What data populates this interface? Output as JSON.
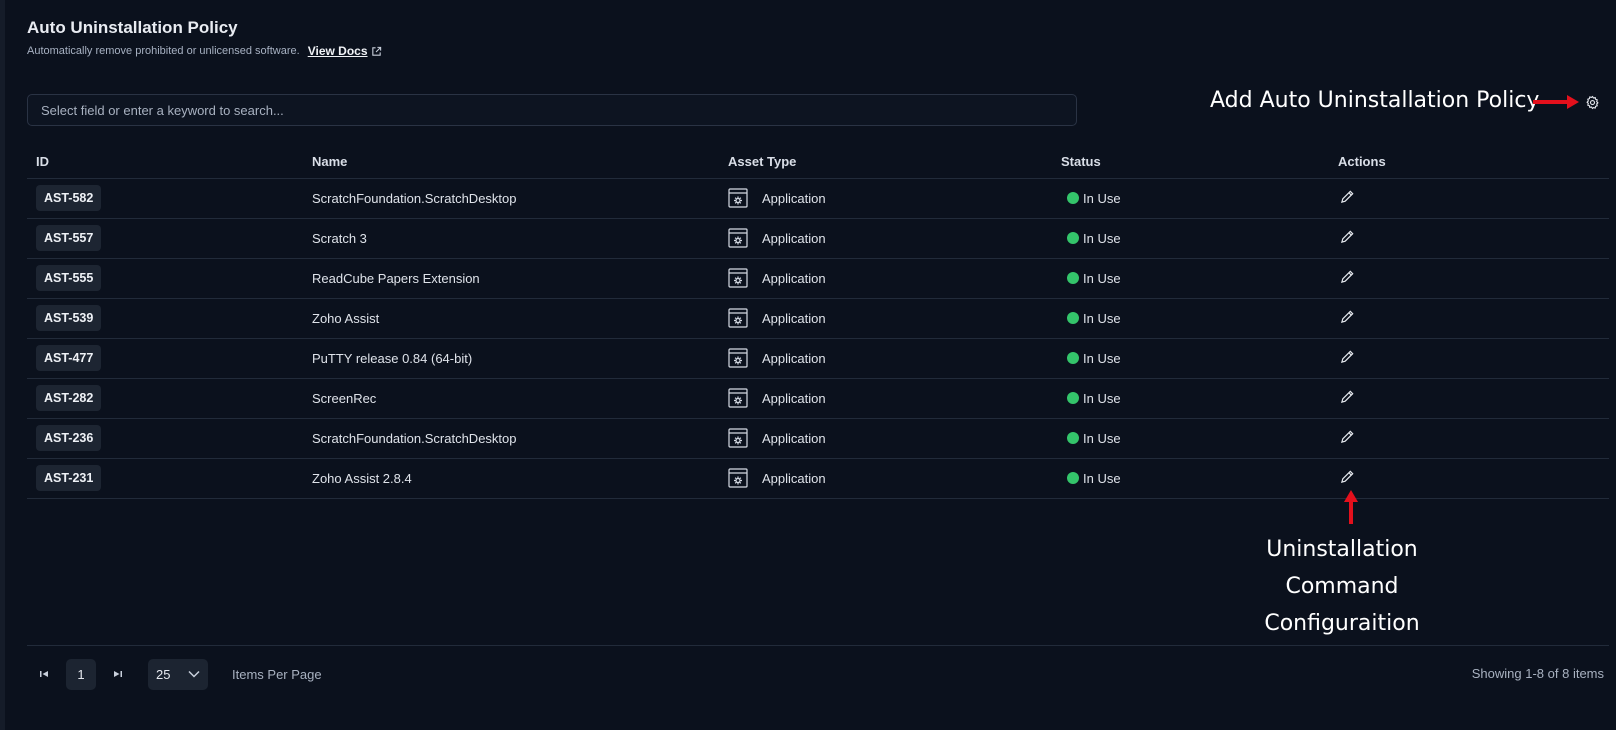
{
  "header": {
    "title": "Auto Uninstallation Policy",
    "subtitle": "Automatically remove prohibited or unlicensed software.",
    "docs_link": "View Docs"
  },
  "search": {
    "placeholder": "Select field or enter a keyword to search..."
  },
  "annotations": {
    "add_policy": "Add Auto Uninstallation Policy",
    "command_line1": "Uninstallation Command",
    "command_line2": "Configuraition"
  },
  "table": {
    "columns": [
      "ID",
      "Name",
      "Asset Type",
      "Status",
      "Actions"
    ],
    "rows": [
      {
        "id": "AST-582",
        "name": "ScratchFoundation.ScratchDesktop",
        "asset_type": "Application",
        "status": "In Use"
      },
      {
        "id": "AST-557",
        "name": "Scratch 3",
        "asset_type": "Application",
        "status": "In Use"
      },
      {
        "id": "AST-555",
        "name": "ReadCube Papers Extension",
        "asset_type": "Application",
        "status": "In Use"
      },
      {
        "id": "AST-539",
        "name": "Zoho Assist",
        "asset_type": "Application",
        "status": "In Use"
      },
      {
        "id": "AST-477",
        "name": "PuTTY release 0.84 (64-bit)",
        "asset_type": "Application",
        "status": "In Use"
      },
      {
        "id": "AST-282",
        "name": "ScreenRec",
        "asset_type": "Application",
        "status": "In Use"
      },
      {
        "id": "AST-236",
        "name": "ScratchFoundation.ScratchDesktop",
        "asset_type": "Application",
        "status": "In Use"
      },
      {
        "id": "AST-231",
        "name": "Zoho Assist 2.8.4",
        "asset_type": "Application",
        "status": "In Use"
      }
    ]
  },
  "pagination": {
    "current_page": "1",
    "per_page": "25",
    "items_per_page_label": "Items Per Page",
    "showing": "Showing 1-8 of 8 items"
  },
  "colors": {
    "background": "#0b111d",
    "status_in_use": "#34c56b",
    "annotation_arrow": "#e4101c"
  }
}
